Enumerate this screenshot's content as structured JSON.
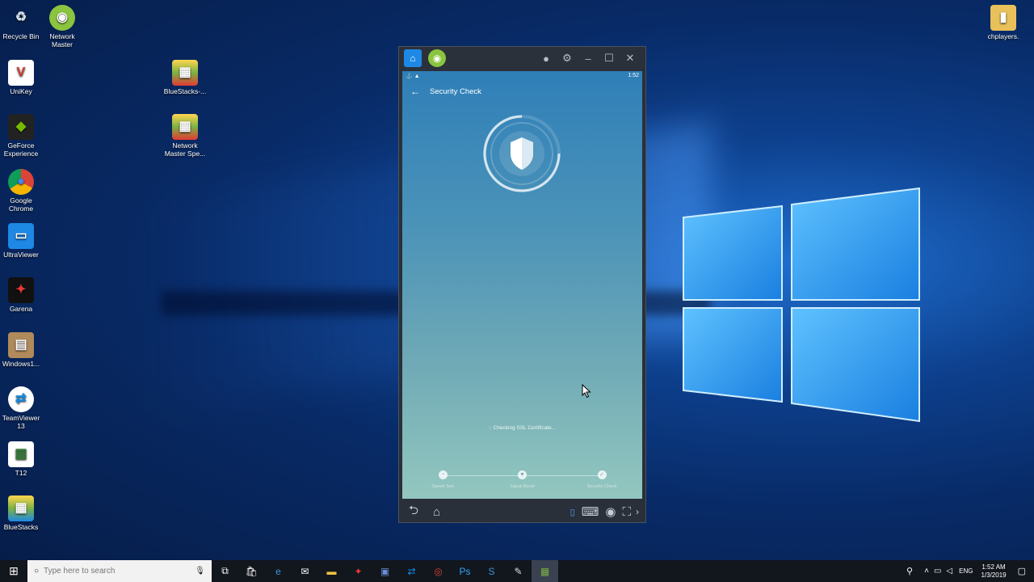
{
  "desktop": {
    "icons": [
      {
        "label": "Recycle Bin",
        "glyph": "♻",
        "color": "#9fb4c8"
      },
      {
        "label": "Network\nMaster",
        "glyph": "◉",
        "color": "#8bc53f"
      },
      {
        "label": "UniKey",
        "glyph": "V",
        "color": "#d23a2e"
      },
      {
        "label": "BlueStacks-...",
        "glyph": "▦",
        "color": "#7cb342"
      },
      {
        "label": "GeForce\nExperience",
        "glyph": "◆",
        "color": "#76b900"
      },
      {
        "label": "Network\nMaster Spe...",
        "glyph": "▦",
        "color": "#7cb342"
      },
      {
        "label": "Google\nChrome",
        "glyph": "◎",
        "color": "#db4437"
      },
      {
        "label": "UltraViewer",
        "glyph": "▭",
        "color": "#1e88e5"
      },
      {
        "label": "Garena",
        "glyph": "✦",
        "color": "#c62828"
      },
      {
        "label": "Windows1...",
        "glyph": "▤",
        "color": "#b08a5a"
      },
      {
        "label": "TeamViewer\n13",
        "glyph": "⇄",
        "color": "#0e8ee9"
      },
      {
        "label": "T12",
        "glyph": "▥",
        "color": "#2e7d32"
      },
      {
        "label": "BlueStacks",
        "glyph": "▦",
        "color": "#7cb342"
      },
      {
        "label": "chplayers.",
        "glyph": "▮",
        "color": "#e8c15a"
      }
    ]
  },
  "emulator": {
    "statusbar": {
      "time": "1:52"
    },
    "app": {
      "title": "Security Check",
      "checking_text": "Checking SSL Certificate...",
      "steps": [
        {
          "label": "Speed Test",
          "icon": "speed-icon"
        },
        {
          "label": "Signal Boost",
          "icon": "signal-icon"
        },
        {
          "label": "Security Check",
          "icon": "shield-icon"
        }
      ]
    }
  },
  "taskbar": {
    "search_placeholder": "Type here to search",
    "language": "ENG",
    "time": "1:52 AM",
    "date": "1/3/2019"
  }
}
